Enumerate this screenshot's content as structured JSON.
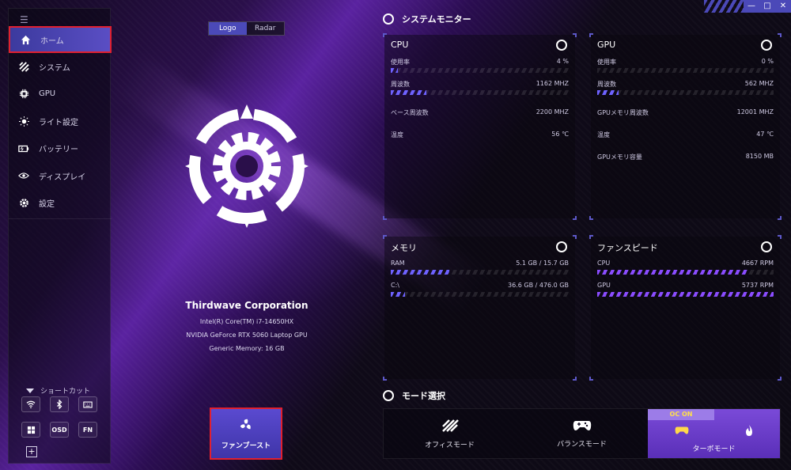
{
  "window": {
    "controls": {
      "minimize": "—",
      "maximize": "□",
      "close": "✕"
    }
  },
  "sidebar": {
    "items": [
      {
        "label": "ホーム",
        "icon": "home-icon",
        "active": true
      },
      {
        "label": "システム",
        "icon": "system-icon"
      },
      {
        "label": "GPU",
        "icon": "gpu-chip-icon"
      },
      {
        "label": "ライト設定",
        "icon": "light-icon"
      },
      {
        "label": "バッテリー",
        "icon": "battery-icon"
      },
      {
        "label": "ディスプレイ",
        "icon": "display-icon"
      },
      {
        "label": "設定",
        "icon": "gear-icon"
      }
    ],
    "shortcut_title": "ショートカット",
    "shortcuts": [
      {
        "label": "",
        "icon": "wifi-icon"
      },
      {
        "label": "",
        "icon": "bluetooth-icon"
      },
      {
        "label": "",
        "icon": "keyboard-icon"
      },
      {
        "label": "",
        "icon": "windows-icon"
      },
      {
        "label": "OSD",
        "icon": "osd-icon"
      },
      {
        "label": "FN",
        "icon": "fn-icon"
      }
    ]
  },
  "center": {
    "toggle": {
      "logo": "Logo",
      "radar": "Radar"
    },
    "company": "Thirdwave Corporation",
    "cpu_name": "Intel(R) Core(TM) i7-14650HX",
    "gpu_name": "NVIDIA GeForce RTX 5060 Laptop GPU",
    "memory": "Generic Memory: 16 GB",
    "fan_boost": "ファンブースト"
  },
  "monitor": {
    "title": "システムモニター",
    "cpu": {
      "title": "CPU",
      "usage_label": "使用率",
      "usage_value": "4 %",
      "usage_fraction": 0.04,
      "freq_label": "周波数",
      "freq_value": "1162 MHZ",
      "freq_fraction": 0.2,
      "base_label": "ベース周波数",
      "base_value": "2200 MHZ",
      "temp_label": "温度",
      "temp_value": "56 ℃"
    },
    "gpu": {
      "title": "GPU",
      "usage_label": "使用率",
      "usage_value": "0 %",
      "usage_fraction": 0.0,
      "freq_label": "周波数",
      "freq_value": "562 MHZ",
      "freq_fraction": 0.12,
      "mem_freq_label": "GPUメモリ周波数",
      "mem_freq_value": "12001 MHZ",
      "temp_label": "温度",
      "temp_value": "47 ℃",
      "mem_cap_label": "GPUメモリ容量",
      "mem_cap_value": "8150 MB"
    },
    "memory": {
      "title": "メモリ",
      "ram_label": "RAM",
      "ram_value": "5.1 GB / 15.7 GB",
      "ram_fraction": 0.33,
      "disk_label": "C:\\",
      "disk_value": "36.6 GB / 476.0 GB",
      "disk_fraction": 0.08
    },
    "fan": {
      "title": "ファンスピード",
      "cpu_label": "CPU",
      "cpu_value": "4667 RPM",
      "cpu_fraction": 0.85,
      "gpu_label": "GPU",
      "gpu_value": "5737 RPM",
      "gpu_fraction": 1.0
    }
  },
  "mode": {
    "title": "モード選択",
    "office": "オフィスモード",
    "balance": "バランスモード",
    "turbo": "ターボモード",
    "oc_badge": "OC ON",
    "accent": "#6e62ff"
  }
}
